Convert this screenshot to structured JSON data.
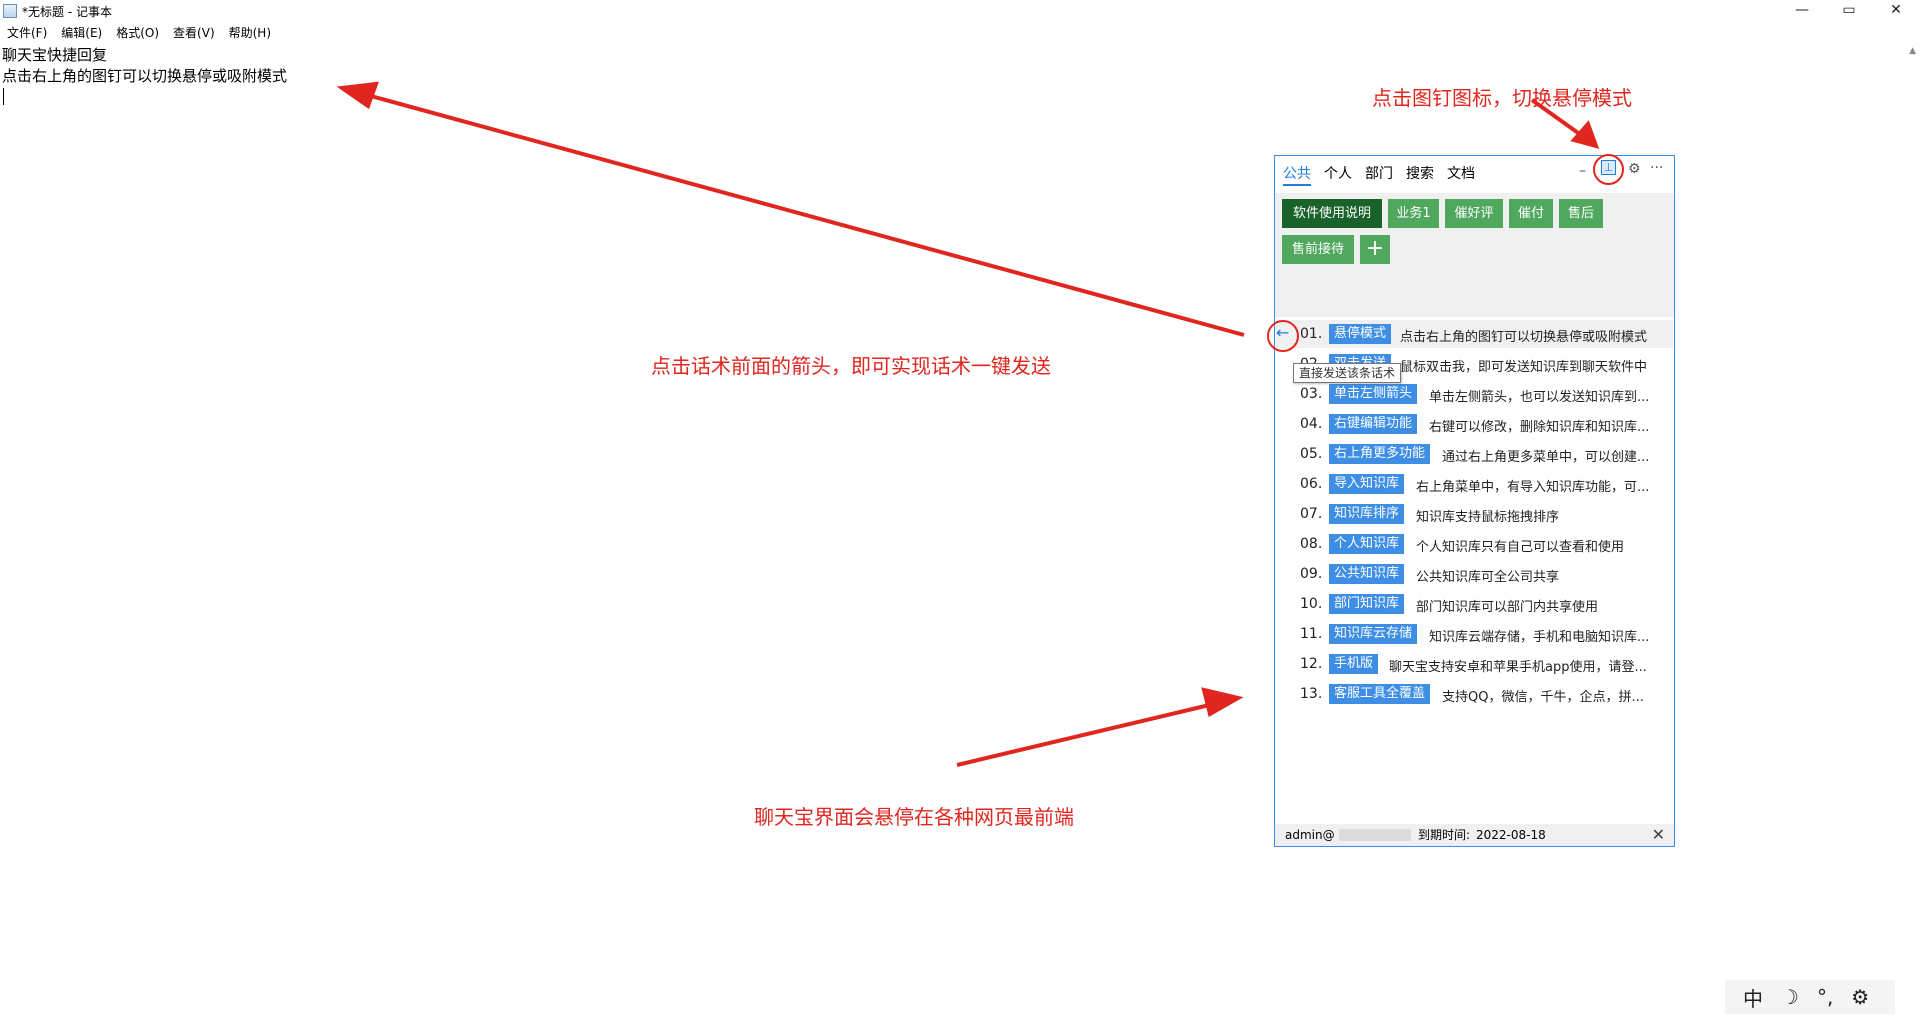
{
  "window": {
    "title": "*无标题 - 记事本",
    "controls": [
      "—",
      "▭",
      "✕"
    ]
  },
  "menu": [
    "文件(F)",
    "编辑(E)",
    "格式(O)",
    "查看(V)",
    "帮助(H)"
  ],
  "editor": {
    "lines": [
      "聊天宝快捷回复",
      "点击右上角的图钉可以切换悬停或吸附模式"
    ]
  },
  "annotations": {
    "pin_hint": "点击图钉图标，切换悬停模式",
    "send_hint": "点击话术前面的箭头，即可实现话术一键发送",
    "float_hint": "聊天宝界面会悬停在各种网页最前端",
    "color": "#e0261e"
  },
  "panel": {
    "tabs": [
      "公共",
      "个人",
      "部门",
      "搜索",
      "文档"
    ],
    "active_tab": "公共",
    "controls": {
      "minimize": "–",
      "settings_icon": "gear-icon",
      "more": "···"
    },
    "categories": [
      "软件使用说明",
      "业务1",
      "催好评",
      "催付",
      "售后",
      "售前接待"
    ],
    "add_label": "+",
    "tooltip": "直接发送该条话术",
    "items": [
      {
        "num": "01.",
        "tag": "悬停模式",
        "desc": "点击右上角的图钉可以切换悬停或吸附模式"
      },
      {
        "num": "02.",
        "tag": "双击发送",
        "desc": "鼠标双击我，即可发送知识库到聊天软件中"
      },
      {
        "num": "03.",
        "tag": "单击左侧箭头",
        "desc": "单击左侧箭头，也可以发送知识库到..."
      },
      {
        "num": "04.",
        "tag": "右键编辑功能",
        "desc": "右键可以修改，删除知识库和知识库..."
      },
      {
        "num": "05.",
        "tag": "右上角更多功能",
        "desc": "通过右上角更多菜单中，可以创建..."
      },
      {
        "num": "06.",
        "tag": "导入知识库",
        "desc": "右上角菜单中，有导入知识库功能，可..."
      },
      {
        "num": "07.",
        "tag": "知识库排序",
        "desc": "知识库支持鼠标拖拽排序"
      },
      {
        "num": "08.",
        "tag": "个人知识库",
        "desc": "个人知识库只有自己可以查看和使用"
      },
      {
        "num": "09.",
        "tag": "公共知识库",
        "desc": "公共知识库可全公司共享"
      },
      {
        "num": "10.",
        "tag": "部门知识库",
        "desc": "部门知识库可以部门内共享使用"
      },
      {
        "num": "11.",
        "tag": "知识库云存储",
        "desc": "知识库云端存储，手机和电脑知识库..."
      },
      {
        "num": "12.",
        "tag": "手机版",
        "desc": "聊天宝支持安卓和苹果手机app使用，请登..."
      },
      {
        "num": "13.",
        "tag": "客服工具全覆盖",
        "desc": "支持QQ，微信，千牛，企点，拼..."
      }
    ],
    "footer": {
      "user": "admin@",
      "expire_label": "到期时间:",
      "expire_date": "2022-08-18",
      "close": "✕"
    },
    "accent": "#3e8ee6",
    "category_color": "#4fa85e",
    "category_active_color": "#19622a"
  },
  "ime": [
    "中",
    "☽",
    "°,",
    "⚙"
  ]
}
